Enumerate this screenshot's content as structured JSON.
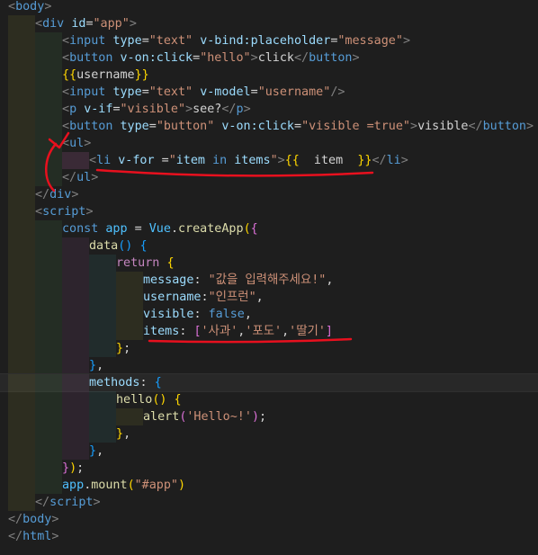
{
  "editor": {
    "lines": [
      {
        "indent": 0,
        "tokens": [
          [
            "t-br",
            "<"
          ],
          [
            "t-tag",
            "body"
          ],
          [
            "t-br",
            ">"
          ]
        ]
      },
      {
        "indent": 1,
        "tokens": [
          [
            "t-br",
            "<"
          ],
          [
            "t-tag",
            "div"
          ],
          [
            "t-text",
            " "
          ],
          [
            "t-attr",
            "id"
          ],
          [
            "t-text",
            "="
          ],
          [
            "t-str",
            "\"app\""
          ],
          [
            "t-br",
            ">"
          ]
        ]
      },
      {
        "indent": 2,
        "tokens": [
          [
            "t-br",
            "<"
          ],
          [
            "t-tag",
            "input"
          ],
          [
            "t-text",
            " "
          ],
          [
            "t-attr",
            "type"
          ],
          [
            "t-text",
            "="
          ],
          [
            "t-str",
            "\"text\""
          ],
          [
            "t-text",
            " "
          ],
          [
            "t-attr",
            "v-bind:placeholder"
          ],
          [
            "t-text",
            "="
          ],
          [
            "t-str",
            "\"message\""
          ],
          [
            "t-br",
            ">"
          ]
        ]
      },
      {
        "indent": 2,
        "tokens": [
          [
            "t-br",
            "<"
          ],
          [
            "t-tag",
            "button"
          ],
          [
            "t-text",
            " "
          ],
          [
            "t-attr",
            "v-on:click"
          ],
          [
            "t-text",
            "="
          ],
          [
            "t-str",
            "\"hello\""
          ],
          [
            "t-br",
            ">"
          ],
          [
            "t-text",
            "click"
          ],
          [
            "t-br",
            "</"
          ],
          [
            "t-tag",
            "button"
          ],
          [
            "t-br",
            ">"
          ]
        ]
      },
      {
        "indent": 2,
        "tokens": [
          [
            "t-brace1",
            "{{"
          ],
          [
            "t-text",
            "username"
          ],
          [
            "t-brace1",
            "}}"
          ]
        ]
      },
      {
        "indent": 2,
        "tokens": [
          [
            "t-br",
            "<"
          ],
          [
            "t-tag",
            "input"
          ],
          [
            "t-text",
            " "
          ],
          [
            "t-attr",
            "type"
          ],
          [
            "t-text",
            "="
          ],
          [
            "t-str",
            "\"text\""
          ],
          [
            "t-text",
            " "
          ],
          [
            "t-attr",
            "v-model"
          ],
          [
            "t-text",
            "="
          ],
          [
            "t-str",
            "\"username\""
          ],
          [
            "t-br",
            "/>"
          ]
        ]
      },
      {
        "indent": 2,
        "tokens": [
          [
            "t-br",
            "<"
          ],
          [
            "t-tag",
            "p"
          ],
          [
            "t-text",
            " "
          ],
          [
            "t-attr",
            "v-if"
          ],
          [
            "t-text",
            "="
          ],
          [
            "t-str",
            "\"visible\""
          ],
          [
            "t-br",
            ">"
          ],
          [
            "t-text",
            "see?"
          ],
          [
            "t-br",
            "</"
          ],
          [
            "t-tag",
            "p"
          ],
          [
            "t-br",
            ">"
          ]
        ]
      },
      {
        "indent": 2,
        "tokens": [
          [
            "t-br",
            "<"
          ],
          [
            "t-tag",
            "button"
          ],
          [
            "t-text",
            " "
          ],
          [
            "t-attr",
            "type"
          ],
          [
            "t-text",
            "="
          ],
          [
            "t-str",
            "\"button\""
          ],
          [
            "t-text",
            " "
          ],
          [
            "t-attr",
            "v-on:click"
          ],
          [
            "t-text",
            "="
          ],
          [
            "t-str",
            "\"visible =true\""
          ],
          [
            "t-br",
            ">"
          ],
          [
            "t-text",
            "visible"
          ],
          [
            "t-br",
            "</"
          ],
          [
            "t-tag",
            "button"
          ],
          [
            "t-br",
            ">"
          ]
        ]
      },
      {
        "indent": 2,
        "tokens": [
          [
            "t-br",
            "<"
          ],
          [
            "t-tag",
            "ul"
          ],
          [
            "t-br",
            ">"
          ]
        ]
      },
      {
        "indent": 3,
        "tokens": [
          [
            "t-br",
            "<"
          ],
          [
            "t-tag",
            "li"
          ],
          [
            "t-text",
            " "
          ],
          [
            "t-attr",
            "v-for"
          ],
          [
            "t-text",
            " ="
          ],
          [
            "t-str",
            "\""
          ],
          [
            "t-prop",
            "item"
          ],
          [
            "t-text",
            " "
          ],
          [
            "t-kw",
            "in"
          ],
          [
            "t-text",
            " "
          ],
          [
            "t-prop",
            "items"
          ],
          [
            "t-str",
            "\""
          ],
          [
            "t-br",
            ">"
          ],
          [
            "t-brace1",
            "{{"
          ],
          [
            "t-text",
            "  item  "
          ],
          [
            "t-brace1",
            "}}"
          ],
          [
            "t-br",
            "</"
          ],
          [
            "t-tag",
            "li"
          ],
          [
            "t-br",
            ">"
          ]
        ],
        "warnGuide": true
      },
      {
        "indent": 2,
        "tokens": [
          [
            "t-br",
            "</"
          ],
          [
            "t-tag",
            "ul"
          ],
          [
            "t-br",
            ">"
          ]
        ]
      },
      {
        "indent": 1,
        "tokens": [
          [
            "t-br",
            "</"
          ],
          [
            "t-tag",
            "div"
          ],
          [
            "t-br",
            ">"
          ]
        ]
      },
      {
        "indent": 1,
        "tokens": [
          [
            "t-br",
            "<"
          ],
          [
            "t-tag",
            "script"
          ],
          [
            "t-br",
            ">"
          ]
        ]
      },
      {
        "indent": 2,
        "tokens": [
          [
            "t-kw",
            "const"
          ],
          [
            "t-text",
            " "
          ],
          [
            "t-var",
            "app"
          ],
          [
            "t-text",
            " = "
          ],
          [
            "t-var",
            "Vue"
          ],
          [
            "t-text",
            "."
          ],
          [
            "t-fn",
            "createApp"
          ],
          [
            "t-brace1",
            "("
          ],
          [
            "t-brace2",
            "{"
          ]
        ]
      },
      {
        "indent": 3,
        "tokens": [
          [
            "t-fn",
            "data"
          ],
          [
            "t-brace3",
            "()"
          ],
          [
            "t-text",
            " "
          ],
          [
            "t-brace3",
            "{"
          ]
        ]
      },
      {
        "indent": 4,
        "tokens": [
          [
            "t-ctrl",
            "return"
          ],
          [
            "t-text",
            " "
          ],
          [
            "t-brace1",
            "{"
          ]
        ]
      },
      {
        "indent": 5,
        "tokens": [
          [
            "t-prop",
            "message"
          ],
          [
            "t-text",
            ": "
          ],
          [
            "t-str",
            "\"값을 입력해주세요!\""
          ],
          [
            "t-text",
            ","
          ]
        ]
      },
      {
        "indent": 5,
        "tokens": [
          [
            "t-prop",
            "username"
          ],
          [
            "t-text",
            ":"
          ],
          [
            "t-str",
            "\"인프런\""
          ],
          [
            "t-text",
            ","
          ]
        ]
      },
      {
        "indent": 5,
        "tokens": [
          [
            "t-prop",
            "visible"
          ],
          [
            "t-text",
            ": "
          ],
          [
            "t-bool",
            "false"
          ],
          [
            "t-text",
            ","
          ]
        ]
      },
      {
        "indent": 5,
        "tokens": [
          [
            "t-prop",
            "items"
          ],
          [
            "t-text",
            ": "
          ],
          [
            "t-brace2",
            "["
          ],
          [
            "t-str",
            "'사과'"
          ],
          [
            "t-text",
            ","
          ],
          [
            "t-str",
            "'포도'"
          ],
          [
            "t-text",
            ","
          ],
          [
            "t-str",
            "'딸기'"
          ],
          [
            "t-brace2",
            "]"
          ]
        ]
      },
      {
        "indent": 4,
        "tokens": [
          [
            "t-brace1",
            "}"
          ],
          [
            "t-text",
            ";"
          ]
        ]
      },
      {
        "indent": 3,
        "tokens": [
          [
            "t-brace3",
            "}"
          ],
          [
            "t-text",
            ","
          ]
        ]
      },
      {
        "indent": 3,
        "tokens": [
          [
            "t-prop",
            "methods"
          ],
          [
            "t-text",
            ": "
          ],
          [
            "t-brace3",
            "{"
          ]
        ],
        "current": true
      },
      {
        "indent": 4,
        "tokens": [
          [
            "t-fn",
            "hello"
          ],
          [
            "t-brace1",
            "()"
          ],
          [
            "t-text",
            " "
          ],
          [
            "t-brace1",
            "{"
          ]
        ]
      },
      {
        "indent": 5,
        "tokens": [
          [
            "t-fn",
            "alert"
          ],
          [
            "t-brace2",
            "("
          ],
          [
            "t-str",
            "'Hello~!'"
          ],
          [
            "t-brace2",
            ")"
          ],
          [
            "t-text",
            ";"
          ]
        ]
      },
      {
        "indent": 4,
        "tokens": [
          [
            "t-brace1",
            "}"
          ],
          [
            "t-text",
            ","
          ]
        ]
      },
      {
        "indent": 3,
        "tokens": [
          [
            "t-brace3",
            "}"
          ],
          [
            "t-text",
            ","
          ]
        ]
      },
      {
        "indent": 2,
        "tokens": [
          [
            "t-brace2",
            "}"
          ],
          [
            "t-brace1",
            ")"
          ],
          [
            "t-text",
            ";"
          ]
        ]
      },
      {
        "indent": 2,
        "tokens": [
          [
            "t-var",
            "app"
          ],
          [
            "t-text",
            "."
          ],
          [
            "t-fn",
            "mount"
          ],
          [
            "t-brace1",
            "("
          ],
          [
            "t-str",
            "\"#app\""
          ],
          [
            "t-brace1",
            ")"
          ]
        ]
      },
      {
        "indent": 1,
        "tokens": [
          [
            "t-br",
            "</"
          ],
          [
            "t-tag",
            "script"
          ],
          [
            "t-br",
            ">"
          ]
        ]
      },
      {
        "indent": 0,
        "tokens": [
          [
            "t-br",
            "</"
          ],
          [
            "t-tag",
            "body"
          ],
          [
            "t-br",
            ">"
          ]
        ]
      },
      {
        "indent": 0,
        "tokens": [
          [
            "t-br",
            "</"
          ],
          [
            "t-tag",
            "html"
          ],
          [
            "t-br",
            ">"
          ]
        ]
      }
    ]
  },
  "annotation_color": "#e8101e"
}
